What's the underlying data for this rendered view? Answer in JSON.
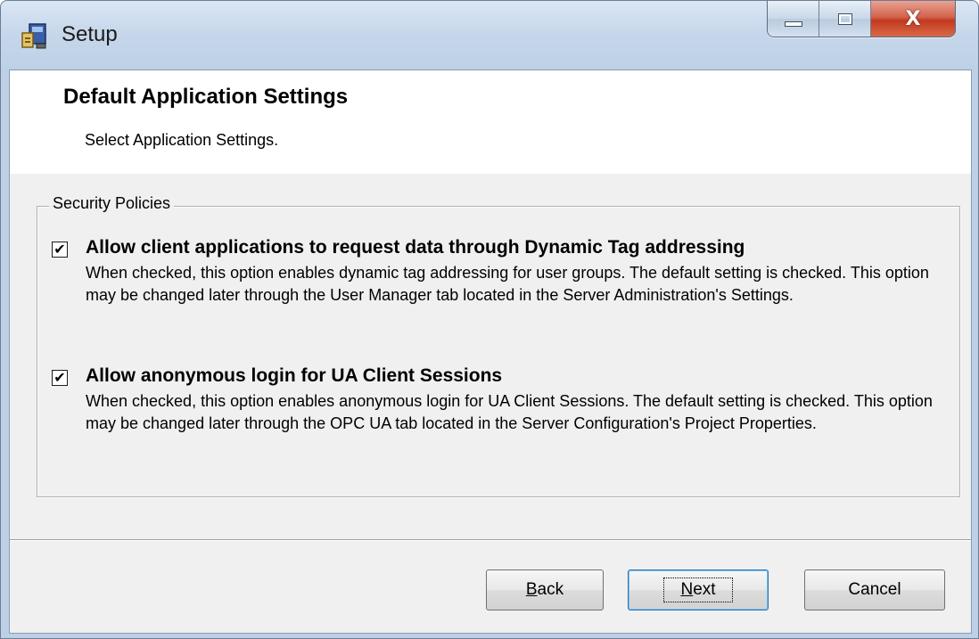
{
  "window": {
    "title": "Setup",
    "app_icon": "setup-installer-icon",
    "caption_buttons": {
      "minimize_icon": "minimize-icon",
      "maximize_icon": "maximize-icon",
      "close_icon": "close-icon",
      "close_glyph": "X"
    }
  },
  "header": {
    "title": "Default Application Settings",
    "subtitle": "Select Application Settings."
  },
  "group": {
    "legend": "Security Policies",
    "options": [
      {
        "checked": true,
        "label": "Allow client applications to request data through Dynamic Tag addressing",
        "description": "When checked, this option enables dynamic tag addressing for user groups. The default setting is checked. This option may be changed later through the User Manager tab located in the Server Administration's Settings."
      },
      {
        "checked": true,
        "label": "Allow anonymous login for UA Client Sessions",
        "description": "When checked, this option enables anonymous login for UA Client Sessions. The default setting is checked. This option may be changed later through the OPC UA tab located in the Server Configuration's Project Properties."
      }
    ]
  },
  "buttons": {
    "back": {
      "mnemonic": "B",
      "rest": "ack"
    },
    "next": {
      "mnemonic": "N",
      "rest": "ext"
    },
    "cancel": "Cancel"
  },
  "checkmark_glyph": "✔",
  "colors": {
    "titlebar": "#c5d6ea",
    "close_button": "#c4391f",
    "dialog_body": "#f0f0f0",
    "default_button_border": "#2a6fb5"
  }
}
